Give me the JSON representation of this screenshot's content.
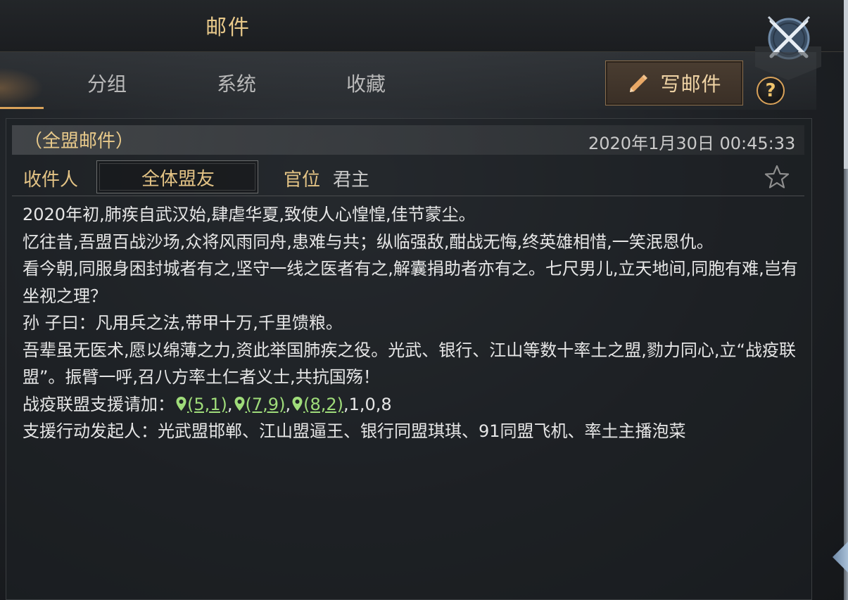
{
  "header": {
    "title": "邮件"
  },
  "tabs": [
    {
      "label": "分组"
    },
    {
      "label": "系统"
    },
    {
      "label": "收藏"
    }
  ],
  "actions": {
    "write_label": "写邮件",
    "help_label": "?"
  },
  "mail": {
    "type_label": "（全盟邮件）",
    "date": "2020年1月30日 00:45:33",
    "recipient_label": "收件人",
    "recipient_value": "全体盟友",
    "rank_label": "官位",
    "rank_value": "君主",
    "body": {
      "line1": "2020年初,肺疾自武汉始,肆虐华夏,致使人心惶惶,佳节蒙尘。",
      "line2": "忆往昔,吾盟百战沙场,众将风雨同舟,患难与共；纵临强敌,酣战无悔,终英雄相惜,一笑泯恩仇。",
      "line3": "看今朝,同服身困封城者有之,坚守一线之医者有之,解囊捐助者亦有之。七尺男儿,立天地间,同胞有难,岂有坐视之理？",
      "line4": "孙 子曰：凡用兵之法,带甲十万,千里馈粮。",
      "line5": "吾辈虽无医术,愿以绵薄之力,资此举国肺疾之役。光武、银行、江山等数十率土之盟,勠力同心,立“战疫联盟”。振臂一呼,召八方率土仁者义士,共抗国殇！",
      "support_prefix": "战疫联盟支援请加：",
      "coords": [
        "(5,1)",
        "(7,9)",
        "(8,2)"
      ],
      "support_suffix": ",1,0,8",
      "line7": "支援行动发起人：光武盟邯郸、江山盟逼王、银行同盟琪琪、91同盟飞机、率土主播泡菜"
    }
  },
  "colors": {
    "gold": "#e3c385",
    "coord_green": "#9fdc7a",
    "active_tab_accent": "#d9a25a"
  },
  "icons": [
    "close-crossed-swords-icon",
    "pencil-icon",
    "help-icon",
    "star-outline-icon",
    "location-pin-icon"
  ]
}
